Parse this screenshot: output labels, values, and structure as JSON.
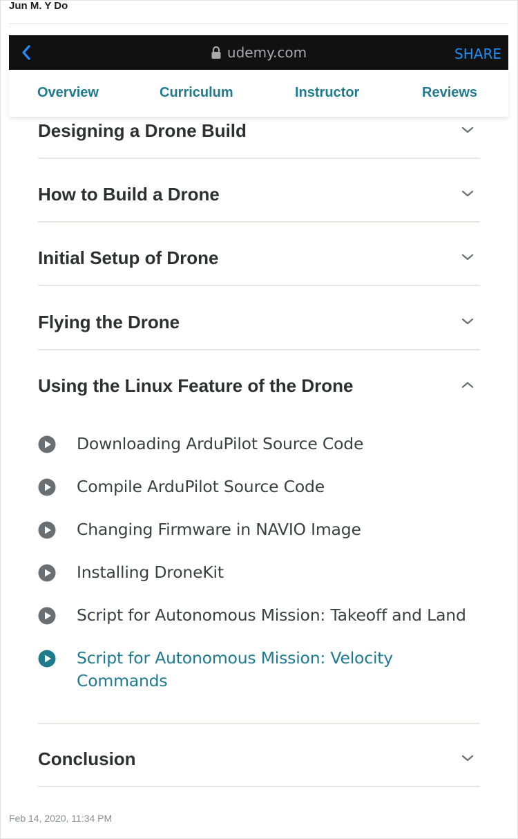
{
  "post": {
    "author": "Jun M. Y Do",
    "timestamp": "Feb 14, 2020, 11:34 PM"
  },
  "browser": {
    "url": "udemy.com",
    "share_label": "SHARE",
    "back_icon": "chevron-left-icon",
    "lock_icon": "lock-icon",
    "accent_color": "#1d8ef6"
  },
  "tabs": [
    {
      "label": "Overview"
    },
    {
      "label": "Curriculum"
    },
    {
      "label": "Instructor"
    },
    {
      "label": "Reviews"
    }
  ],
  "curriculum": {
    "sections": [
      {
        "title": "Designing a Drone Build",
        "expanded": false
      },
      {
        "title": "How to Build a Drone",
        "expanded": false
      },
      {
        "title": "Initial Setup of Drone",
        "expanded": false
      },
      {
        "title": "Flying the Drone",
        "expanded": false
      },
      {
        "title": "Using the Linux Feature of the Drone",
        "expanded": true
      },
      {
        "title": "Conclusion",
        "expanded": false
      }
    ],
    "lectures": [
      {
        "title": "Downloading ArduPilot Source Code",
        "active": false
      },
      {
        "title": "Compile ArduPilot Source Code",
        "active": false
      },
      {
        "title": "Changing Firmware in NAVIO Image",
        "active": false
      },
      {
        "title": "Installing DroneKit",
        "active": false
      },
      {
        "title": "Script for Autonomous Mission: Takeoff and Land",
        "active": false
      },
      {
        "title": "Script for Autonomous Mission: Velocity Commands",
        "active": true
      }
    ],
    "tab_color": "#1e7b8e",
    "play_icon_color": "#6a6f73",
    "active_color": "#1e7b8e"
  }
}
